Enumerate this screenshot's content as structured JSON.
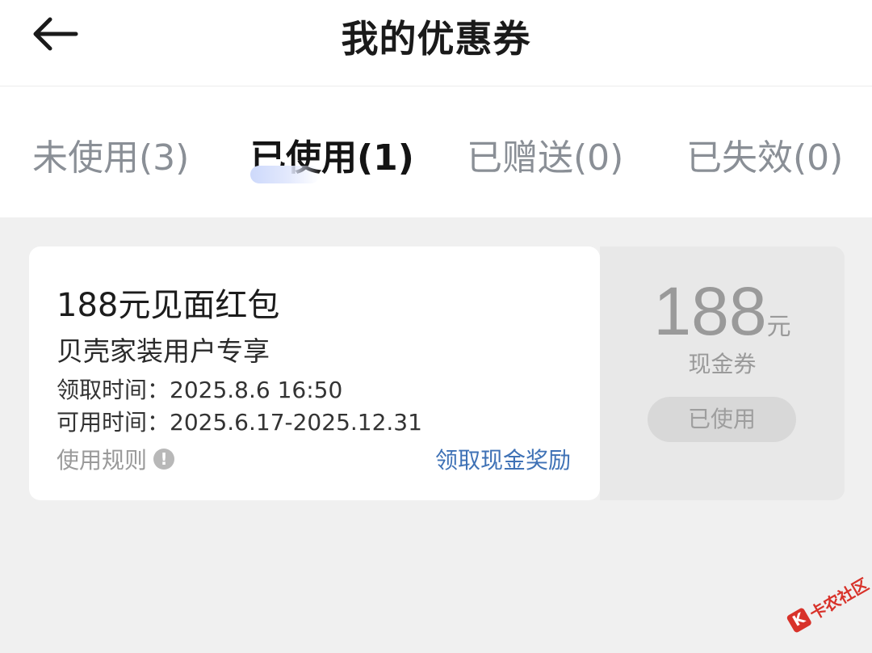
{
  "header": {
    "title": "我的优惠券",
    "back_icon": "arrow-left-icon"
  },
  "tabs": [
    {
      "label": "未使用(3)",
      "active": false
    },
    {
      "label": "已使用(1)",
      "active": true
    },
    {
      "label": "已赠送(0)",
      "active": false
    },
    {
      "label": "已失效(0)",
      "active": false
    }
  ],
  "coupon": {
    "name": "188元见面红包",
    "description": "贝壳家装用户专享",
    "claim_time_label": "领取时间：",
    "claim_time": "2025.8.6 16:50",
    "valid_time_label": "可用时间：",
    "valid_time": "2025.6.17-2025.12.31",
    "rules_label": "使用规则",
    "rules_icon": "!",
    "claim_link": "领取现金奖励",
    "amount": "188",
    "amount_unit": "元",
    "type": "现金券",
    "status": "已使用"
  },
  "watermark": {
    "text": "卡农社区",
    "logo": "K"
  },
  "colors": {
    "background": "#f0f0f0",
    "link": "#3f72b6",
    "tab_active": "#141414",
    "tab_inactive": "#8a8f96",
    "used_gray": "#9a9a9a",
    "watermark": "#d8322a"
  }
}
